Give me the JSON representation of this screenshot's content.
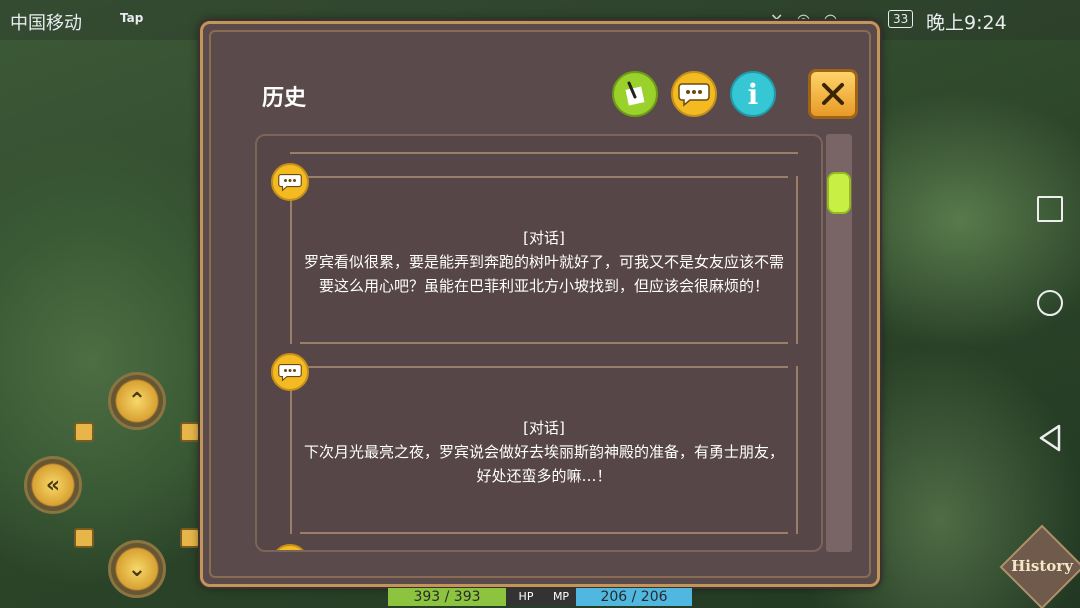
{
  "status_bar": {
    "carrier": "中国移动",
    "tap_label": "Tap",
    "battery": "33",
    "time": "晚上9:24"
  },
  "dialog": {
    "title": "历史",
    "buttons": {
      "note_icon": "note-icon",
      "chat_icon": "chat-bubble-icon",
      "info_label": "i",
      "close_icon": "close-x-icon"
    },
    "entries": [
      {
        "type": "[对话]",
        "text": "罗宾看似很累，要是能弄到奔跑的树叶就好了，可我又不是女友应该不需要这么用心吧？虽能在巴菲利亚北方小坡找到，但应该会很麻烦的！"
      },
      {
        "type": "[对话]",
        "text": "下次月光最亮之夜，罗宾说会做好去埃丽斯韵神殿的准备，有勇士朋友，好处还蛮多的嘛…！"
      }
    ]
  },
  "hud": {
    "hp_value": "393 / 393",
    "hp_label": "HP",
    "mp_label": "MP",
    "mp_value": "206 / 206",
    "history_label": "History"
  },
  "colors": {
    "panel": "#5a4a4b",
    "frame_gold": "#c09659",
    "hp_green": "#8cc43f",
    "mp_blue": "#4fb7e0",
    "accent_yellow": "#f3bb21"
  }
}
